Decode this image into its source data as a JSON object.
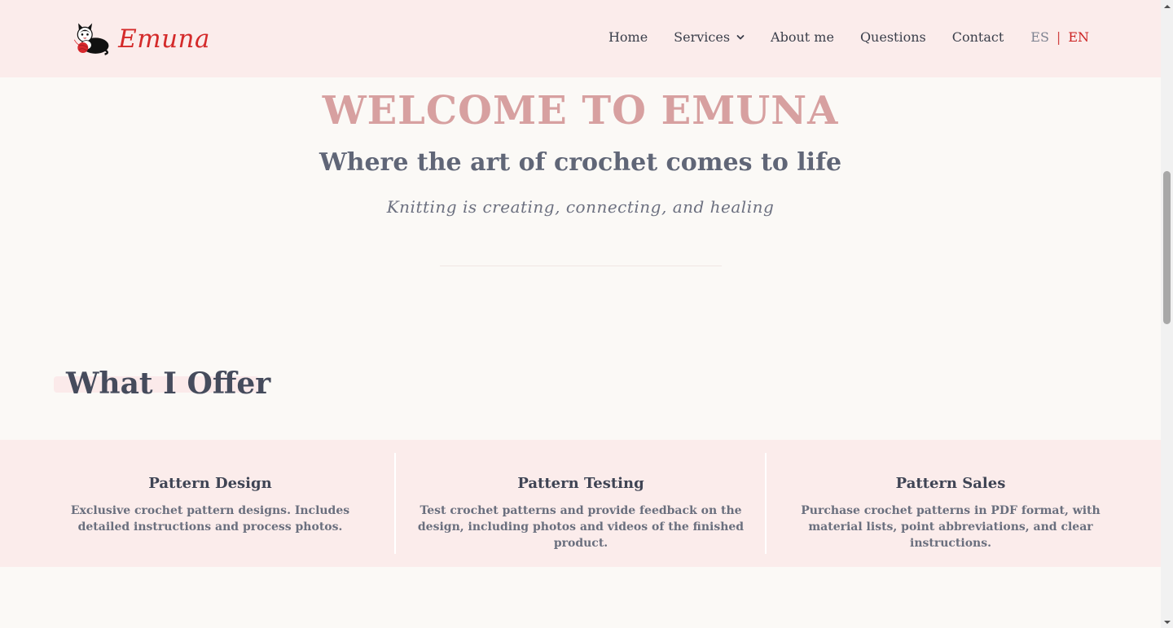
{
  "header": {
    "logo_text": "Emuna",
    "nav": [
      {
        "label": "Home"
      },
      {
        "label": "Services"
      },
      {
        "label": "About me"
      },
      {
        "label": "Questions"
      },
      {
        "label": "Contact"
      }
    ],
    "lang": {
      "es": "ES",
      "sep": "|",
      "en": "EN"
    }
  },
  "hero": {
    "title": "WELCOME TO EMUNA",
    "subtitle": "Where the art of crochet comes to life",
    "tagline": "Knitting is creating, connecting, and healing"
  },
  "offer": {
    "heading": "What I Offer",
    "services": [
      {
        "title": "Pattern Design",
        "desc": "Exclusive crochet pattern designs. Includes detailed instructions and process photos."
      },
      {
        "title": "Pattern Testing",
        "desc": "Test crochet patterns and provide feedback on the design, including photos and videos of the finished product."
      },
      {
        "title": "Pattern Sales",
        "desc": "Purchase crochet patterns in PDF format, with material lists, point abbreviations, and clear instructions."
      }
    ]
  },
  "colors": {
    "header_bg": "#fbeceb",
    "page_bg": "#fbf9f6",
    "brand_red": "#d42a2a",
    "hero_title": "#d7a0a0",
    "band_bg": "#fbeceb"
  },
  "icons": {
    "logo": "cat-with-yarn-icon",
    "services_dropdown": "chevron-down-icon"
  }
}
